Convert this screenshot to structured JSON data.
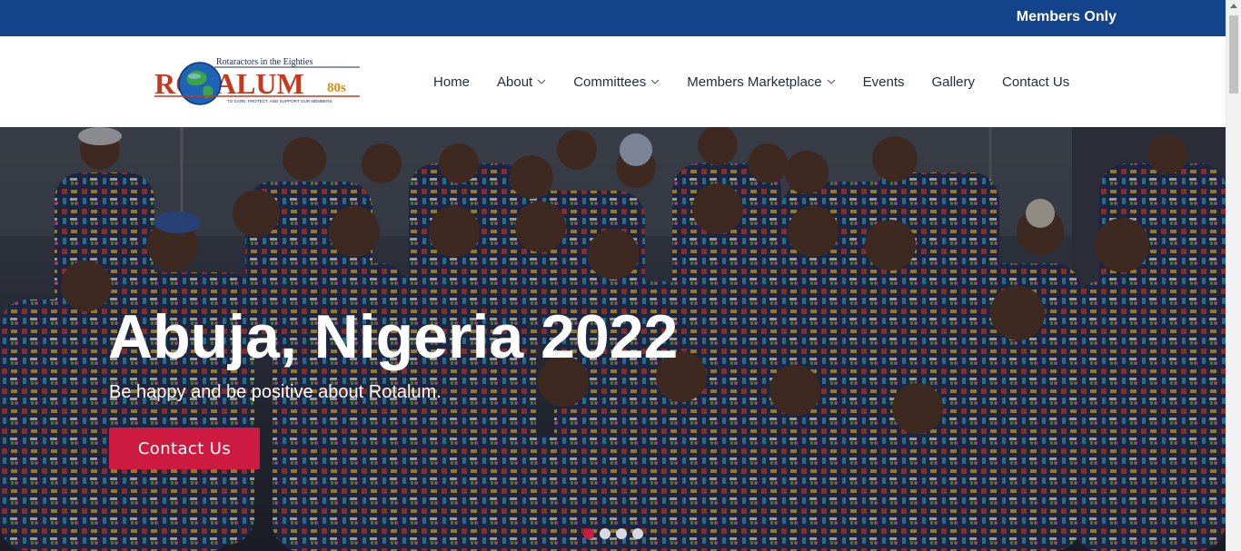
{
  "topbar": {
    "members_label": "Members Only",
    "bg_color": "#13438a"
  },
  "logo": {
    "tagline": "Rotaractors in the Eighties",
    "word": "ROTALUM",
    "suffix": "80s",
    "motto": "TO CARE, PROTECT, AND SUPPORT OUR MEMBERS"
  },
  "nav": {
    "items": [
      {
        "label": "Home",
        "has_dropdown": false
      },
      {
        "label": "About",
        "has_dropdown": true
      },
      {
        "label": "Committees",
        "has_dropdown": true
      },
      {
        "label": "Members Marketplace",
        "has_dropdown": true
      },
      {
        "label": "Events",
        "has_dropdown": false
      },
      {
        "label": "Gallery",
        "has_dropdown": false
      },
      {
        "label": "Contact Us",
        "has_dropdown": false
      }
    ]
  },
  "hero": {
    "title": "Abuja, Nigeria 2022",
    "subtitle": "Be happy and be positive about Rotalum.",
    "button_label": "Contact Us",
    "button_color": "#cc1a40",
    "slide_count": 4,
    "active_slide": 1
  },
  "icons": {
    "dropdown": "chevron-down-icon",
    "scroll_up": "arrow-up-icon"
  }
}
